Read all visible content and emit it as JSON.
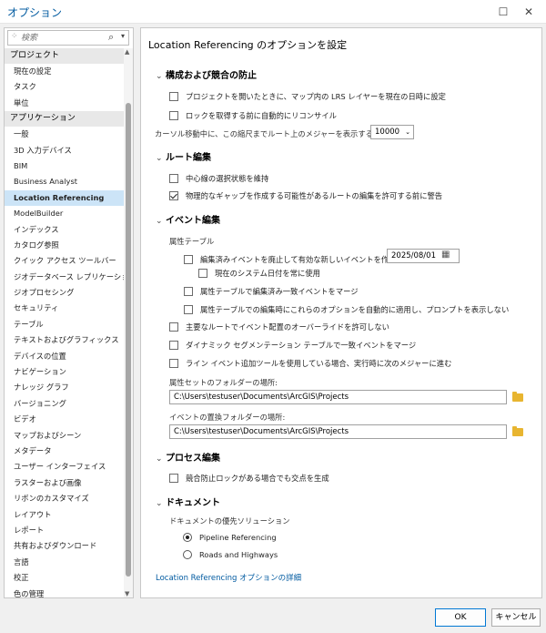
{
  "window": {
    "title": "オプション",
    "minimize_glyph": "☐",
    "close_glyph": "✕"
  },
  "sidebar": {
    "search_placeholder": "検索",
    "categories": [
      {
        "header": "プロジェクト",
        "items": [
          "現在の設定",
          "タスク",
          "単位"
        ]
      },
      {
        "header": "アプリケーション",
        "items": [
          "一般",
          "3D 入力デバイス",
          "BIM",
          "Business Analyst",
          "Location Referencing",
          "ModelBuilder",
          "インデックス",
          "カタログ参照",
          "クイック アクセス ツールバー",
          "ジオデータベース レプリケーション",
          "ジオプロセシング",
          "セキュリティ",
          "テーブル",
          "テキストおよびグラフィックス",
          "デバイスの位置",
          "ナビゲーション",
          "ナレッジ グラフ",
          "バージョニング",
          "ビデオ",
          "マップおよびシーン",
          "メタデータ",
          "ユーザー インターフェイス",
          "ラスターおよび画像",
          "リボンのカスタマイズ",
          "レイアウト",
          "レポート",
          "共有およびダウンロード",
          "言語",
          "校正",
          "色の管理"
        ]
      }
    ],
    "selected": "Location Referencing"
  },
  "main": {
    "title": "Location Referencing のオプションを設定",
    "sections": {
      "conflict": {
        "title": "構成および競合の防止",
        "opt1": "プロジェクトを開いたときに、マップ内の LRS レイヤーを現在の日時に設定",
        "opt1_checked": false,
        "opt2": "ロックを取得する前に自動的にリコンサイル",
        "opt2_checked": false,
        "scale_label": "カーソル移動中に、この縮尺までルート上のメジャーを表示する",
        "scale_value": "10000"
      },
      "route": {
        "title": "ルート編集",
        "opt1": "中心線の選択状態を維持",
        "opt1_checked": false,
        "opt2": "物理的なギャップを作成する可能性があるルートの編集を許可する前に警告",
        "opt2_checked": true
      },
      "event": {
        "title": "イベント編集",
        "attr_table_label": "属性テーブル",
        "retire_opt": "編集済みイベントを廃止して有効な新しいイベントを作成",
        "retire_checked": false,
        "retire_date": "2025/08/01",
        "use_today": "現在のシステム日付を常に使用",
        "use_today_checked": false,
        "merge_opt": "属性テーブルで編集済み一致イベントをマージ",
        "merge_checked": false,
        "auto_apply_opt": "属性テーブルでの編集時にこれらのオプションを自動的に適用し、プロンプトを表示しない",
        "auto_apply_checked": false,
        "override_opt": "主要なルートでイベント配置のオーバーライドを許可しない",
        "override_checked": false,
        "dynseg_opt": "ダイナミック セグメンテーション テーブルで一致イベントをマージ",
        "dynseg_checked": false,
        "line_tool_opt": "ライン イベント追加ツールを使用している場合、実行時に次のメジャーに進む",
        "line_tool_checked": false,
        "attr_folder_label": "属性セットのフォルダーの場所:",
        "attr_folder_path": "C:\\Users\\testuser\\Documents\\ArcGIS\\Projects",
        "replace_folder_label": "イベントの置換フォルダーの場所:",
        "replace_folder_path": "C:\\Users\\testuser\\Documents\\ArcGIS\\Projects"
      },
      "process": {
        "title": "プロセス編集",
        "opt1": "競合防止ロックがある場合でも交点を生成",
        "opt1_checked": false
      },
      "document": {
        "title": "ドキュメント",
        "solution_label": "ドキュメントの優先ソリューション",
        "radio1": "Pipeline Referencing",
        "radio1_selected": true,
        "radio2": "Roads and Highways",
        "radio2_selected": false
      }
    },
    "details_link": "Location Referencing オプションの詳細"
  },
  "footer": {
    "ok": "OK",
    "cancel": "キャンセル"
  }
}
